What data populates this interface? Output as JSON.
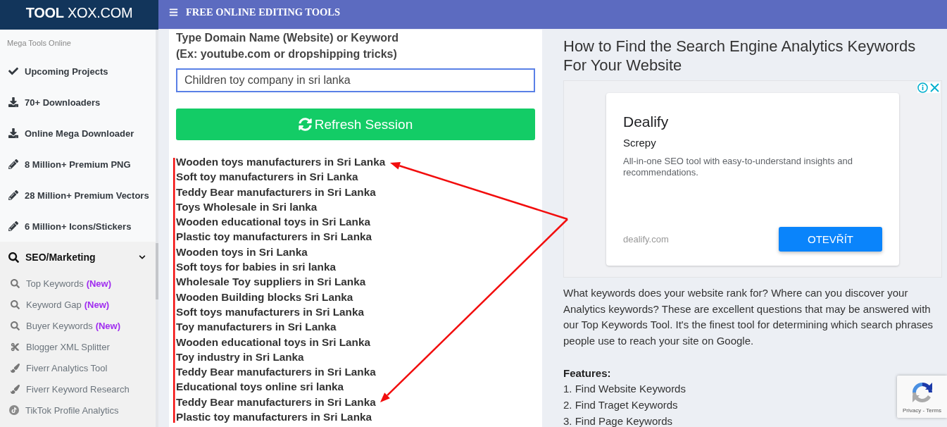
{
  "logo": {
    "text": "**TOOL** XOX.COM"
  },
  "header": {
    "title": "FREE ONLINE EDITING TOOLS"
  },
  "sidebar": {
    "caption": "Mega Tools Online",
    "items": [
      {
        "label": "Upcoming Projects"
      },
      {
        "label": "70+ Downloaders"
      },
      {
        "label": "Online Mega Downloader"
      },
      {
        "label": "8 Million+ Premium PNG"
      },
      {
        "label": "28 Million+ Premium Vectors"
      },
      {
        "label": "6 Million+ Icons/Stickers"
      }
    ],
    "sections": [
      {
        "label": "SEO/Marketing",
        "expanded": true,
        "children": [
          {
            "label": "Top Keywords",
            "badge": "(New)"
          },
          {
            "label": "Keyword Gap",
            "badge": "(New)"
          },
          {
            "label": "Buyer Keywords",
            "badge": "(New)"
          },
          {
            "label": "Blogger XML Splitter"
          },
          {
            "label": "Fiverr Analytics Tool"
          },
          {
            "label": "Fiverr Keyword Research"
          },
          {
            "label": "TikTok Profile Analytics"
          }
        ]
      }
    ]
  },
  "search_form": {
    "label": "Type Domain Name (Website) or Keyword",
    "hint": "(Ex: youtube.com or dropshipping tricks)",
    "input": {
      "value": "Children toy company in sri lanka"
    },
    "button": "Refresh Session"
  },
  "keywords": [
    "Wooden toys manufacturers in Sri Lanka",
    "Soft toy manufacturers in Sri Lanka",
    "Teddy Bear manufacturers in Sri Lanka",
    "Toys Wholesale in Sri lanka",
    "Wooden educational toys in Sri Lanka",
    "Plastic toy manufacturers in Sri Lanka",
    "Wooden toys in Sri Lanka",
    "Soft toys for babies in sri lanka",
    "Wholesale Toy suppliers in Sri Lanka",
    "Wooden Building blocks Sri Lanka",
    "Soft toys manufacturers in Sri Lanka",
    "Toy manufacturers in Sri Lanka",
    "Wooden educational toys in Sri Lanka",
    "Toy industry in Sri Lanka",
    "Teddy Bear manufacturers in Sri Lanka",
    "Educational toys online sri lanka",
    "Teddy Bear manufacturers in Sri Lanka",
    "Plastic toy manufacturers in Sri Lanka"
  ],
  "article": {
    "title": "How to Find the Search Engine Analytics Keywords For Your Website",
    "ad": {
      "title": "Dealify",
      "subtitle": "Screpy",
      "description": "All-in-one SEO tool with easy-to-understand insights and recommendations.",
      "domain": "dealify.com",
      "button": "OTEVŘÍT"
    },
    "intro": "What keywords does your website rank for? Where can you discover your Analytics keywords? These are excellent questions that may be answered with our Top Keywords Tool. It's the finest tool for determining which search phrases people use to reach your site on Google.",
    "features_heading": "Features:",
    "features": [
      "1. Find Website Keywords",
      "2. Find Traget Keywords",
      "3. Find Page Keywords"
    ]
  },
  "verification_badge": {
    "links": "Privacy - Terms"
  }
}
